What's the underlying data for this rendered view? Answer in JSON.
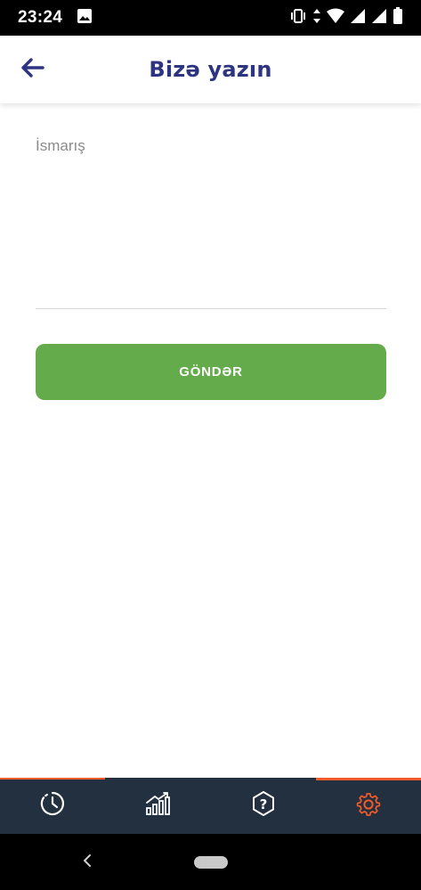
{
  "status_bar": {
    "time": "23:24",
    "icons": [
      "image-notification-icon",
      "vibrate-icon",
      "data-arrows-icon",
      "wifi-icon",
      "signal-icon",
      "signal-icon-2",
      "battery-icon"
    ]
  },
  "app_bar": {
    "title": "Bizə yazın",
    "back_icon": "arrow-left-icon",
    "title_color": "#2d3481"
  },
  "form": {
    "message_label": "İsmarış",
    "message_value": "",
    "send_label": "GÖNDƏR",
    "send_color": "#64ab4b"
  },
  "bottom_nav": {
    "background": "#233040",
    "accent": "#f15a29",
    "items": [
      {
        "icon": "history-icon",
        "active": false
      },
      {
        "icon": "statistics-icon",
        "active": false
      },
      {
        "icon": "help-icon",
        "active": false
      },
      {
        "icon": "settings-icon",
        "active": true
      }
    ]
  },
  "system_nav": {
    "back_icon": "chevron-left-icon",
    "home_icon": "home-pill"
  }
}
